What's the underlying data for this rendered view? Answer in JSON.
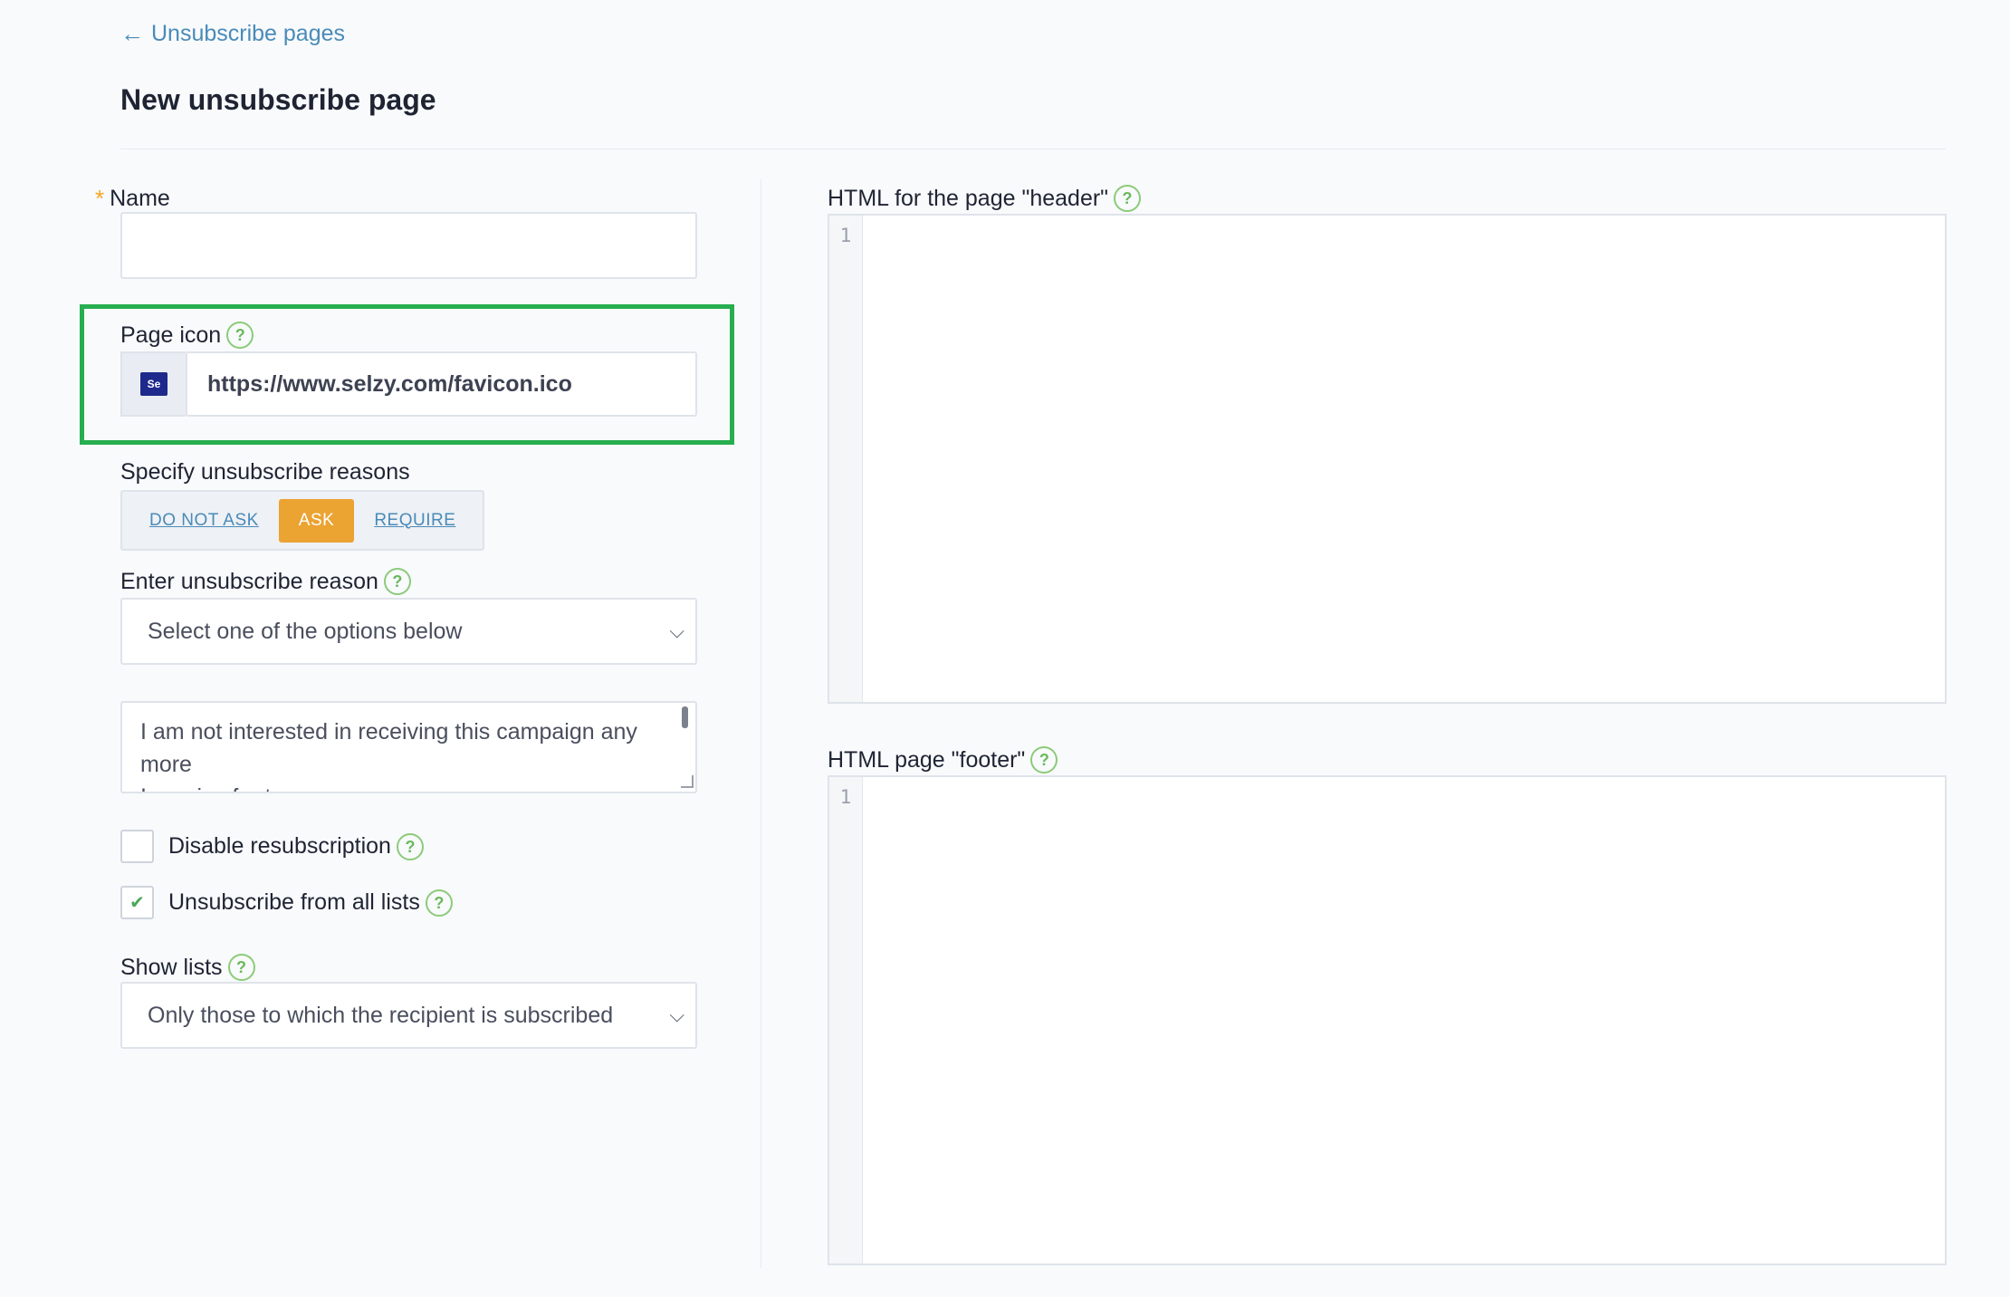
{
  "nav": {
    "back_arrow": "←",
    "back_label": "Unsubscribe pages"
  },
  "page": {
    "title": "New unsubscribe page"
  },
  "form": {
    "name": {
      "required_mark": "*",
      "label": "Name",
      "value": ""
    },
    "page_icon": {
      "label": "Page icon",
      "favicon_text": "Se",
      "value": "https://www.selzy.com/favicon.ico"
    },
    "reasons_mode": {
      "label": "Specify unsubscribe reasons",
      "options": [
        "DO NOT ASK",
        "ASK",
        "REQUIRE"
      ],
      "selected": "ASK"
    },
    "reason_select": {
      "label": "Enter unsubscribe reason",
      "value": "Select one of the options below"
    },
    "reasons_text": {
      "value": "I am not interested in receiving this campaign any more\nI receive far too many"
    },
    "disable_resubscription": {
      "label": "Disable resubscription",
      "checked": false
    },
    "unsubscribe_all": {
      "label": "Unsubscribe from all lists",
      "checked": true
    },
    "show_lists": {
      "label": "Show lists",
      "value": "Only those to which the recipient is subscribed"
    }
  },
  "editors": {
    "header": {
      "label": "HTML for the page \"header\"",
      "line_number": "1"
    },
    "footer": {
      "label": "HTML page \"footer\"",
      "line_number": "1"
    }
  },
  "icons": {
    "help": "?",
    "chevron": "⌵",
    "check": "✔"
  },
  "colors": {
    "link": "#4a8bb8",
    "active_segment": "#eba332",
    "highlight_border": "#27ae4f",
    "help_icon": "#6ab95a",
    "required_star": "#f5a623"
  }
}
